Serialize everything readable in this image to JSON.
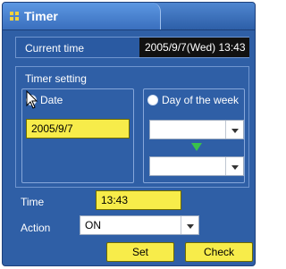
{
  "window": {
    "title": "Timer"
  },
  "current_time": {
    "label": "Current time",
    "value": "2005/9/7(Wed) 13:43"
  },
  "timer_setting": {
    "label": "Timer setting",
    "date_option": {
      "label": "Date",
      "selected": true,
      "value": "2005/9/7"
    },
    "week_option": {
      "label": "Day of the week",
      "selected": false,
      "from_value": "",
      "to_value": ""
    }
  },
  "time": {
    "label": "Time",
    "value": "13:43"
  },
  "action": {
    "label": "Action",
    "value": "ON"
  },
  "buttons": {
    "set": "Set",
    "check": "Check"
  },
  "colors": {
    "window": "#2f5fa6",
    "field": "#f7ec4a",
    "accent_arrow": "#39c24a"
  },
  "icons": {
    "title": "grid-icon",
    "cursor": "mouse-pointer-icon"
  }
}
